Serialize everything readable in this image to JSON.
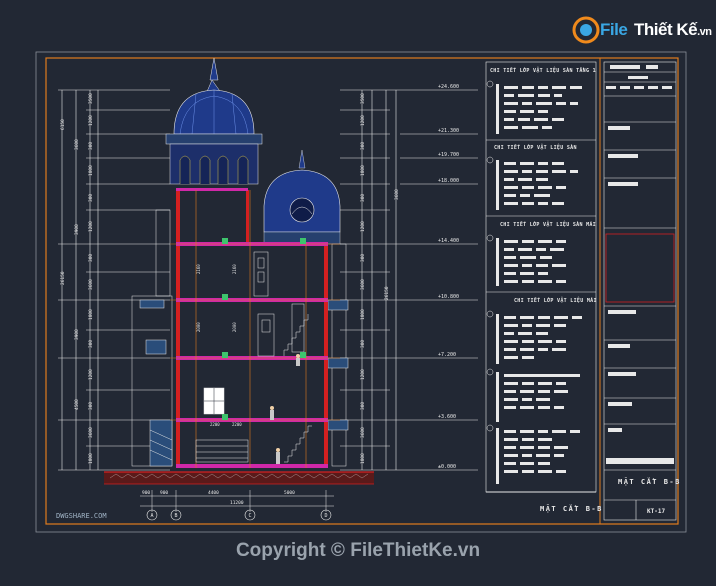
{
  "watermark_logo": {
    "file": "File",
    "rest": "Thiết Kế",
    "domain": ".vn"
  },
  "copyright": "Copyright © FileThietKe.vn",
  "site_watermark": "DWGSHARE.COM",
  "section_title": "MẶT CẮT B-B",
  "title_block": {
    "drawing_title": "MẶT CẮT B-B",
    "sheet_code": "KT-17"
  },
  "notes": [
    "CHI TIẾT LỚP VẬT LIỆU SÀN TẦNG 1",
    "CHI TIẾT LỚP VẬT LIỆU SÀN",
    "CHI TIẾT LỚP VẬT LIỆU SÀN MÁI",
    "CHI TIẾT LỚP VẬT LIỆU MÁI"
  ],
  "left_dimensions": [
    "3500",
    "1200",
    "300",
    "1800",
    "300",
    "1200",
    "300",
    "3600",
    "1800",
    "300",
    "1200",
    "300",
    "3600",
    "1800",
    "600",
    "1800"
  ],
  "left_totals": [
    "6150",
    "26150",
    "3600",
    "3900",
    "3900",
    "4500"
  ],
  "right_dimensions": [
    "3500",
    "1200",
    "300",
    "1800",
    "300",
    "1200",
    "300",
    "3600",
    "1800",
    "300",
    "1200",
    "300",
    "3600",
    "1800",
    "600",
    "1800"
  ],
  "right_totals": [
    "26150",
    "3600"
  ],
  "levels": [
    "+24.600",
    "+21.300",
    "+19.700",
    "+18.000",
    "+14.400",
    "+10.800",
    "+7.200",
    "+3.600",
    "±0.000"
  ],
  "bottom_dimensions": [
    "900",
    "900",
    "4400",
    "5000"
  ],
  "bottom_total": "11200",
  "grid_axes": [
    "A",
    "B",
    "C",
    "D"
  ],
  "interior_dims": [
    "2160",
    "2160",
    "2000",
    "2000",
    "2200",
    "2200"
  ],
  "colors": {
    "background": "#222834",
    "frame": "#e07b1e",
    "cad_white": "#e8e8e8",
    "dome_blue": "#1f3a8a",
    "floor_magenta": "#d028a8",
    "wall_red": "#d42020",
    "dim_green": "#3ec46d"
  }
}
